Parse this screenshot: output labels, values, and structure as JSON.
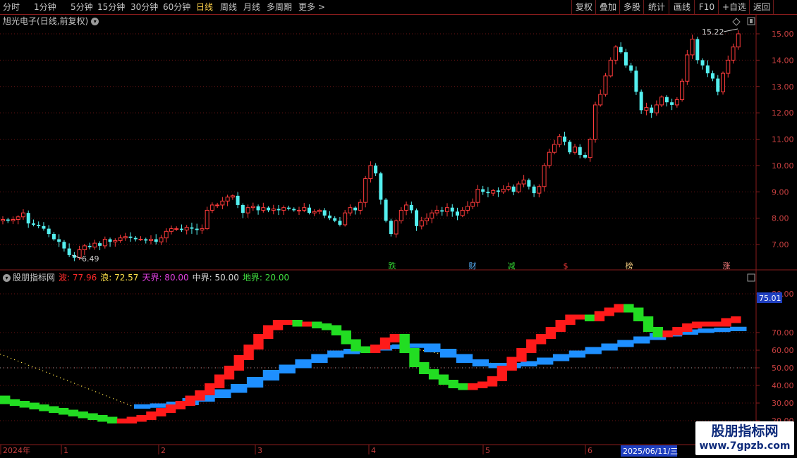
{
  "toolbar": {
    "periods": [
      "分时",
      "1分钟",
      "5分钟",
      "15分钟",
      "30分钟",
      "60分钟",
      "日线",
      "周线",
      "月线",
      "多周期",
      "更多"
    ],
    "active_period": "日线",
    "right_buttons": [
      "复权",
      "叠加",
      "多股",
      "统计",
      "画线",
      "F10",
      "+自选",
      "返回"
    ]
  },
  "header": {
    "stock_name": "旭光电子",
    "period_label": "(日线,前复权)"
  },
  "price_axis": {
    "ticks": [
      "15.00",
      "14.00",
      "13.00",
      "12.00",
      "11.00",
      "10.00",
      "9.00",
      "8.00",
      "7.00"
    ],
    "max_label": "15.22",
    "min_label": "6.49"
  },
  "event_markers": [
    {
      "label": "跌",
      "color": "#33d633"
    },
    {
      "label": "财",
      "color": "#5ab4ff"
    },
    {
      "label": "减",
      "color": "#33d633"
    },
    {
      "label": "$",
      "color": "#ff3b3b"
    },
    {
      "label": "榜",
      "color": "#e8c27a"
    },
    {
      "label": "涨",
      "color": "#ff8080"
    }
  ],
  "indicator": {
    "name": "股朋指标网",
    "wave_label": "波: 77.96",
    "lang_label": "浪: 72.57",
    "tianjie_label": "天界: 80.00",
    "zhongjie_label": "中界: 50.00",
    "dijie_label": "地界: 20.00",
    "colors": {
      "wave": "#ff2a2a",
      "lang": "#ffe24a",
      "tianjie": "#e040e0",
      "zhongjie": "#d8d8d8",
      "dijie": "#40e040"
    },
    "current_value": "75.01",
    "ticks": [
      "80.00",
      "70.00",
      "60.00",
      "50.00",
      "40.00",
      "30.00",
      "20.00"
    ]
  },
  "date_axis": {
    "labels": [
      "2024年",
      "1",
      "2",
      "3",
      "4",
      "5",
      "6"
    ],
    "cursor_date": "2025/06/11/三"
  },
  "watermark": {
    "title": "股朋指标网",
    "url": "www.7gpzb.com"
  },
  "chart_data": {
    "type": "candlestick",
    "price_range": [
      6.5,
      15.22
    ],
    "candles_close": [
      7.95,
      7.9,
      7.95,
      8.05,
      8.2,
      7.8,
      7.75,
      7.7,
      7.6,
      7.4,
      7.2,
      7.1,
      6.85,
      6.6,
      6.5,
      6.8,
      6.95,
      6.9,
      7.05,
      6.95,
      7.2,
      7.1,
      7.15,
      7.25,
      7.3,
      7.25,
      7.2,
      7.2,
      7.15,
      7.2,
      7.1,
      7.25,
      7.5,
      7.6,
      7.6,
      7.55,
      7.65,
      7.6,
      7.55,
      7.6,
      8.3,
      8.5,
      8.5,
      8.65,
      8.8,
      8.85,
      8.5,
      8.2,
      8.4,
      8.45,
      8.3,
      8.4,
      8.3,
      8.35,
      8.3,
      8.4,
      8.35,
      8.3,
      8.3,
      8.4,
      8.2,
      8.25,
      8.3,
      8.1,
      8.0,
      7.9,
      7.75,
      8.2,
      8.4,
      8.3,
      8.6,
      9.5,
      10.0,
      9.7,
      8.7,
      7.9,
      7.4,
      7.9,
      8.3,
      8.5,
      8.3,
      7.7,
      7.9,
      8.0,
      8.2,
      8.3,
      8.25,
      8.4,
      8.25,
      8.1,
      8.3,
      8.45,
      8.6,
      9.1,
      9.0,
      8.95,
      9.05,
      9.0,
      9.1,
      9.2,
      9.0,
      9.3,
      9.45,
      9.2,
      8.95,
      9.2,
      10.0,
      10.5,
      10.8,
      11.1,
      10.9,
      10.5,
      10.7,
      10.4,
      10.3,
      11.0,
      12.3,
      12.7,
      13.4,
      14.0,
      14.5,
      14.3,
      13.8,
      13.6,
      12.8,
      12.1,
      12.2,
      12.0,
      12.3,
      12.6,
      12.4,
      12.3,
      12.5,
      13.2,
      14.2,
      14.8,
      14.0,
      13.8,
      13.5,
      13.3,
      12.8,
      13.5,
      14.0,
      14.5,
      15.0
    ],
    "indicator_range": [
      20,
      90
    ],
    "wave_values": [
      33,
      31,
      30,
      29,
      28,
      27,
      26,
      25,
      24,
      23,
      22,
      21,
      20,
      20,
      21,
      22,
      24,
      26,
      28,
      30,
      33,
      36,
      40,
      45,
      50,
      56,
      62,
      68,
      73,
      76,
      76,
      75,
      75,
      74,
      73,
      70,
      65,
      61,
      60,
      62,
      66,
      68,
      60,
      52,
      48,
      45,
      42,
      40,
      39,
      40,
      41,
      44,
      50,
      55,
      60,
      65,
      68,
      72,
      76,
      79,
      79,
      78,
      81,
      83,
      85,
      83,
      78,
      72,
      69,
      70,
      72,
      74,
      75,
      75,
      75,
      77,
      78
    ],
    "lang_values": [
      28,
      28.5,
      29,
      30,
      32,
      34,
      37,
      40,
      44,
      48,
      51,
      54,
      57,
      59,
      60,
      61,
      62,
      62.5,
      63,
      60,
      57,
      54,
      52,
      51,
      52,
      53,
      55,
      57,
      59,
      61,
      63,
      65,
      67,
      69,
      70,
      71,
      71.5,
      72,
      72.5
    ]
  }
}
